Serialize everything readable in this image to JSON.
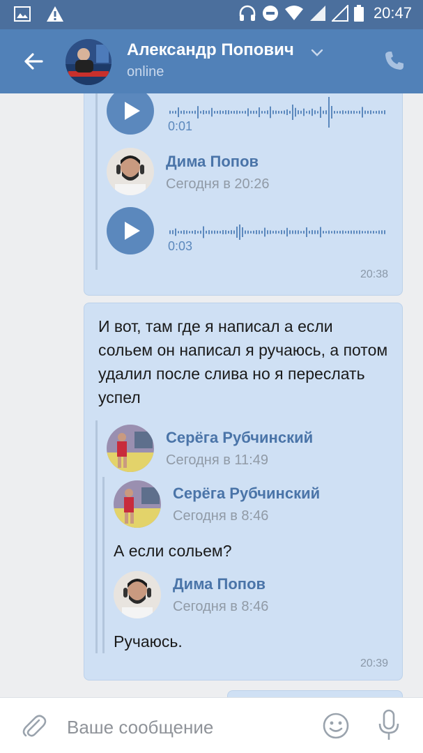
{
  "status_bar": {
    "time": "20:47"
  },
  "header": {
    "contact_name": "Александр Попович",
    "status": "online"
  },
  "messages": [
    {
      "voice_1_duration": "0:01",
      "forward_sender": "Дима Попов",
      "forward_when": "Сегодня в 20:26",
      "voice_2_duration": "0:03",
      "time": "20:38"
    },
    {
      "text": "И вот, там где я написал а если сольем он написал я ручаюсь, а потом удалил после слива но я переслать успел",
      "fwd1_sender": "Серёга Рубчинский",
      "fwd1_when": "Сегодня в 11:49",
      "fwd2_sender": "Серёга Рубчинский",
      "fwd2_when": "Сегодня в 8:46",
      "fwd2_text": "А если сольем?",
      "fwd3_sender": "Дима Попов",
      "fwd3_when": "Сегодня в 8:46",
      "fwd3_text": "Ручаюсь.",
      "time": "20:39"
    }
  ],
  "input": {
    "placeholder": "Ваше сообщение"
  },
  "colors": {
    "header": "#5181b8",
    "bubble": "#cfe0f4",
    "accent": "#5b88bd"
  }
}
